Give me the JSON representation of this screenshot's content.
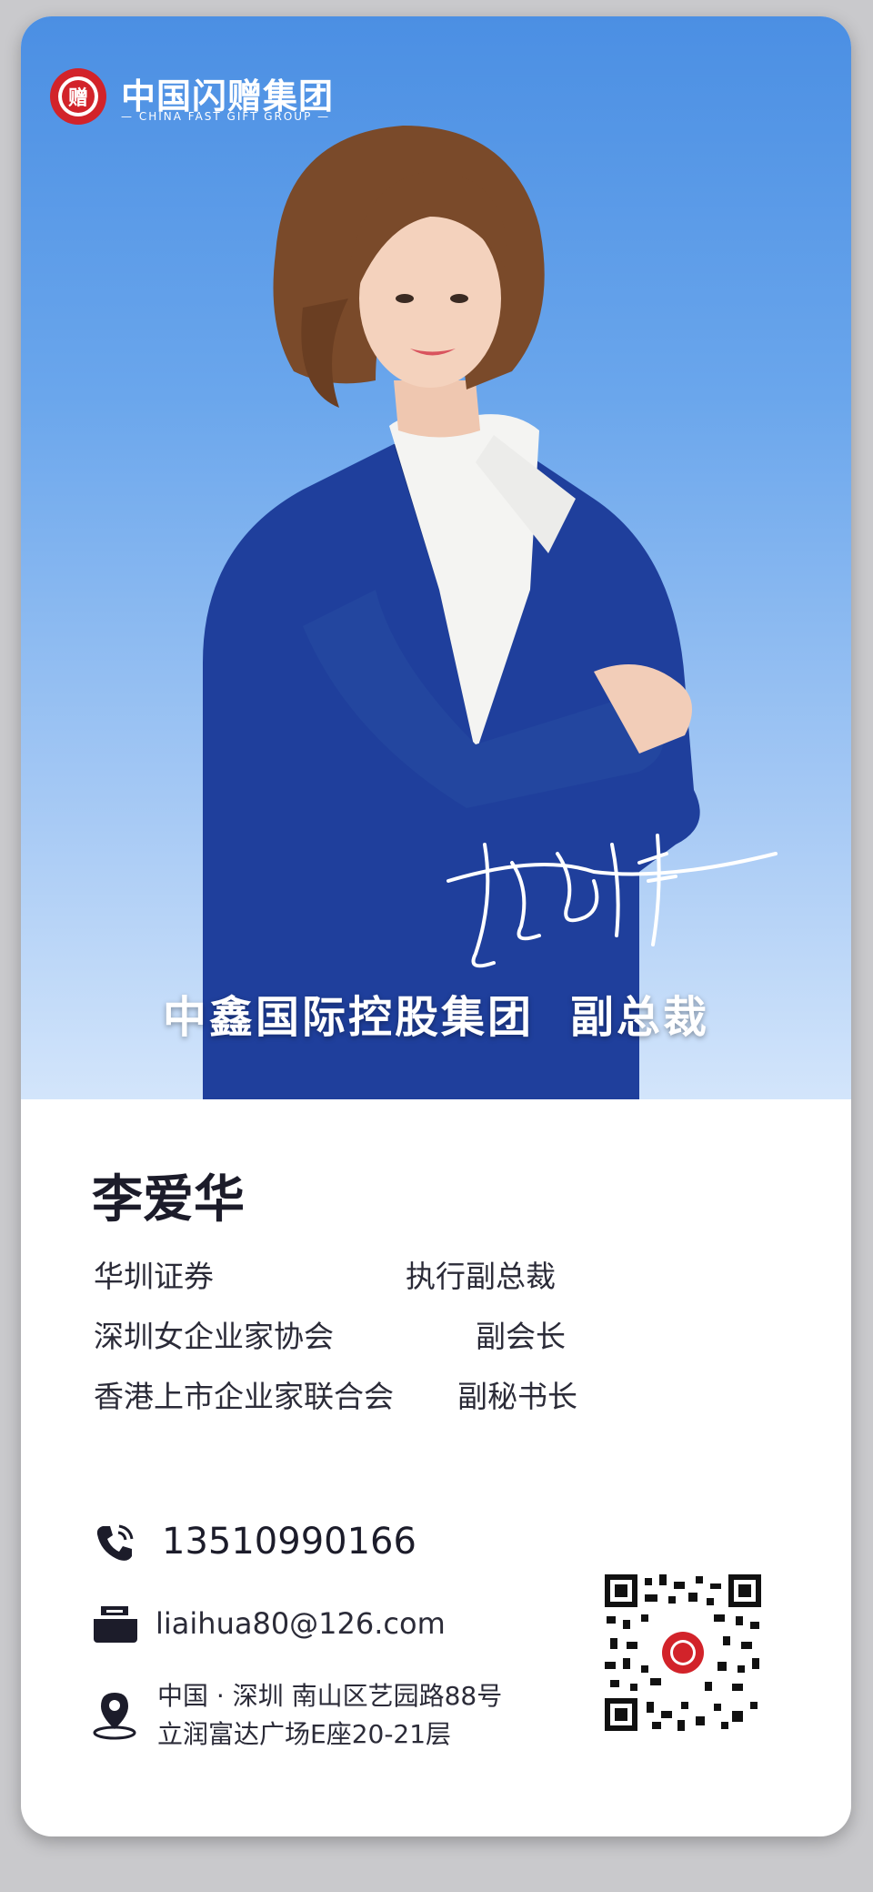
{
  "brand": {
    "name_cn": "中国闪赠集团",
    "name_en": "CHINA FAST GIFT GROUP",
    "logo_char": "赠",
    "color": "#d2232a"
  },
  "hero": {
    "company": "中鑫国际控股集团",
    "role": "副总裁"
  },
  "profile": {
    "name": "李爱华",
    "positions": [
      {
        "org": "华圳证券",
        "title": "执行副总裁"
      },
      {
        "org": "深圳女企业家协会",
        "title": "副会长"
      },
      {
        "org": "香港上市企业家联合会",
        "title": "副秘书长"
      }
    ]
  },
  "contact": {
    "phone": "13510990166",
    "email": "liaihua80@126.com",
    "address_line1": "中国 · 深圳  南山区艺园路88号",
    "address_line2": "立润富达广场E座20-21层"
  },
  "colors": {
    "hero_top": "#4b8fe3",
    "hero_bottom": "#d3e5fb",
    "suit": "#1f3f9c",
    "text_dark": "#1c1c2a"
  },
  "icons": [
    "phone-icon",
    "mail-icon",
    "location-pin-icon",
    "qr-code-icon"
  ]
}
